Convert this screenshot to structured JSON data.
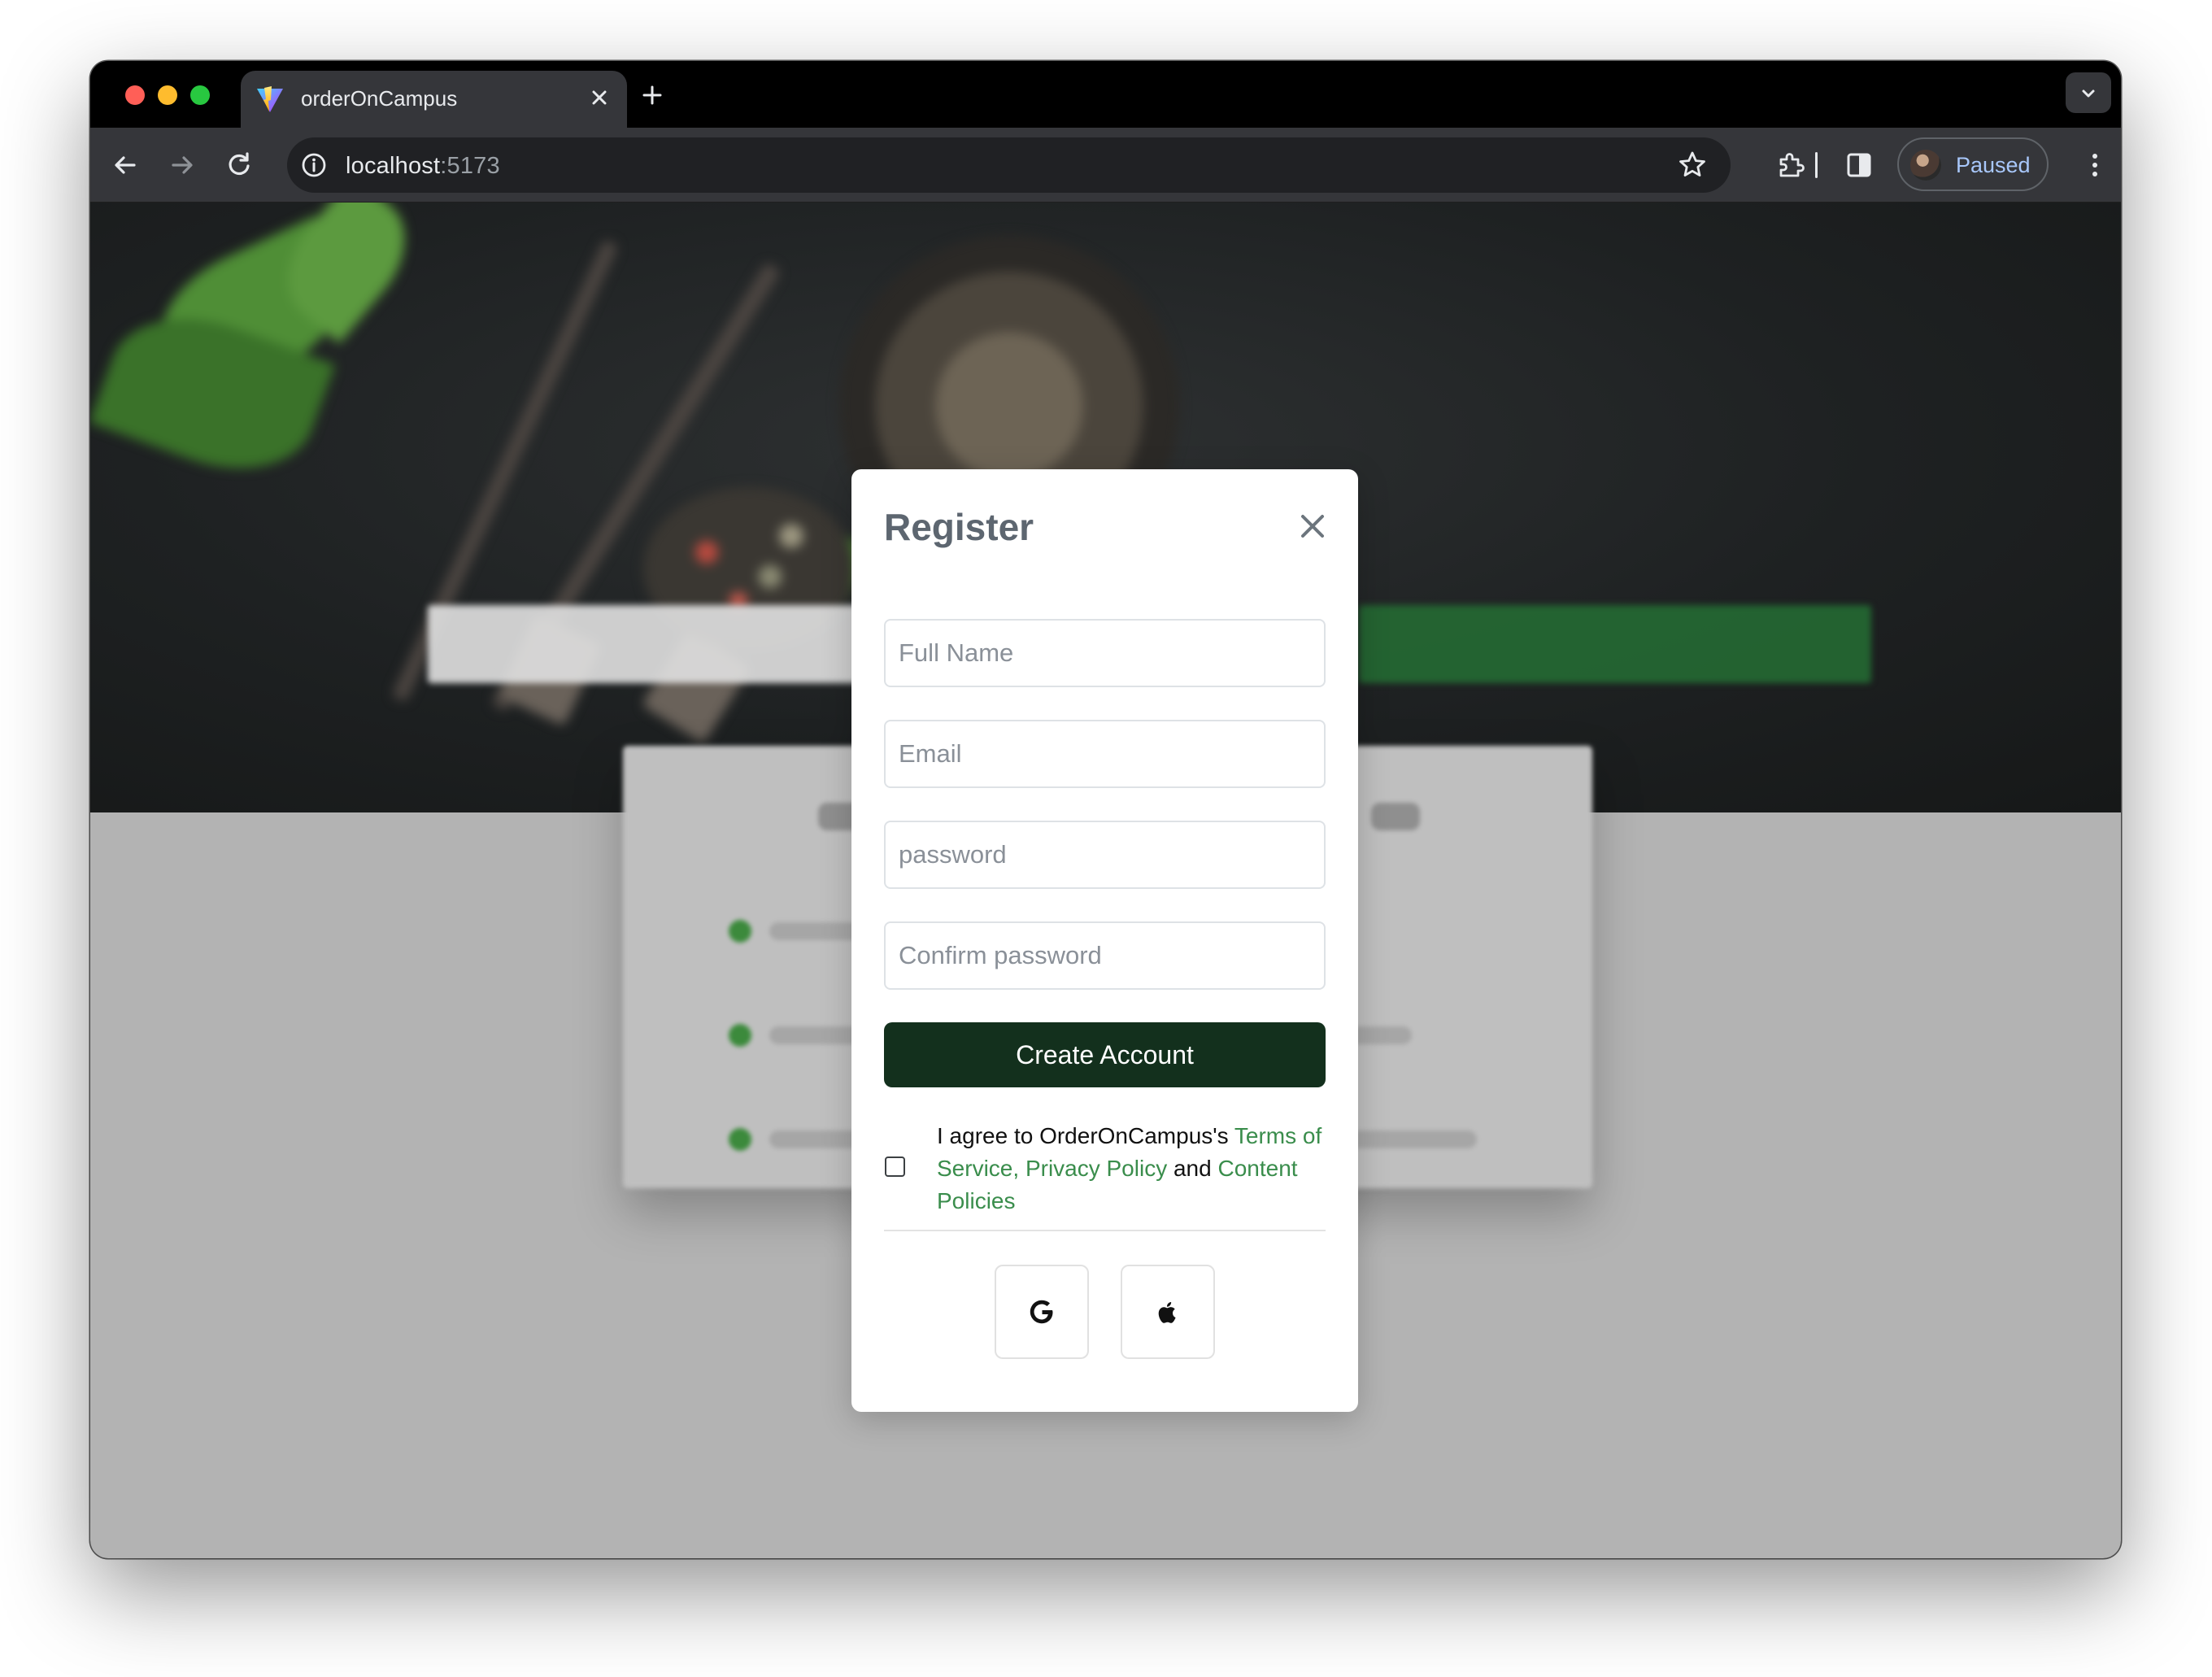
{
  "browser": {
    "tab": {
      "title": "orderOnCampus"
    },
    "address": {
      "host": "localhost",
      "port": ":5173"
    },
    "profile": {
      "label": "Paused"
    }
  },
  "modal": {
    "title": "Register",
    "fields": {
      "full_name_placeholder": "Full Name",
      "email_placeholder": "Email",
      "password_placeholder": "password",
      "confirm_password_placeholder": "Confirm password"
    },
    "submit_label": "Create Account",
    "agreement": {
      "prefix": "I agree to OrderOnCampus's ",
      "terms_link": "Terms of Service,",
      "privacy_link": "Privacy Policy",
      "conjunction": " and ",
      "content_link": "Content Policies"
    },
    "social": {
      "google_icon": "google-icon",
      "apple_icon": "apple-icon"
    }
  },
  "colors": {
    "primary_button": "#13301d",
    "link": "#3a8d4c",
    "overlay": "#b3b3b3"
  }
}
